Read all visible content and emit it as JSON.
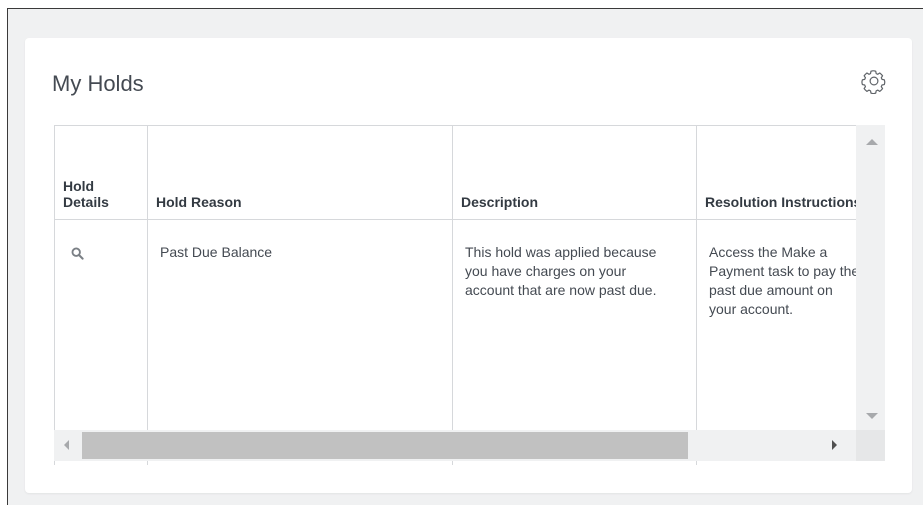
{
  "card": {
    "title": "My Holds",
    "settings_icon": "gear-icon"
  },
  "table": {
    "columns": [
      "Hold Details",
      "Hold Reason",
      "Description",
      "Resolution Instructions"
    ],
    "rows": [
      {
        "details_icon": "search-icon",
        "hold_reason": "Past Due Balance",
        "description": "This hold was applied because you have charges on your account that are now past due.",
        "resolution": [
          "Access the Make a",
          "Payment task to pay the",
          "past due amount on",
          "your account."
        ]
      }
    ]
  },
  "colors": {
    "page_background": "#f0f1f2",
    "card_background": "#ffffff",
    "border": "#d6d8db",
    "scrollbar_thumb": "#c1c1c1",
    "text": "#444a52"
  }
}
